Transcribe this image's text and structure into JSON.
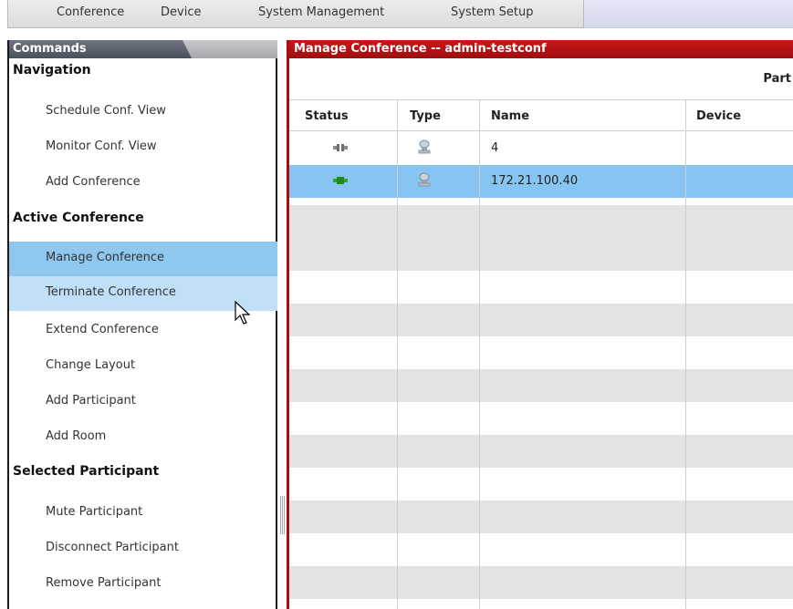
{
  "menu": {
    "items": [
      "Conference",
      "Device",
      "System Management",
      "System Setup"
    ]
  },
  "commands": {
    "title": "Commands",
    "sections": [
      {
        "label": "Navigation",
        "items": [
          "Schedule Conf. View",
          "Monitor Conf. View",
          "Add Conference"
        ]
      },
      {
        "label": "Active Conference",
        "items": [
          "Manage Conference",
          "Terminate Conference",
          "Extend Conference",
          "Change Layout",
          "Add Participant",
          "Add Room"
        ]
      },
      {
        "label": "Selected Participant",
        "items": [
          "Mute Participant",
          "Disconnect Participant",
          "Remove Participant"
        ]
      }
    ],
    "selected_item": "Manage Conference",
    "hovered_item": "Terminate Conference"
  },
  "main": {
    "title": "Manage Conference -- admin-testconf",
    "subheader": "Part",
    "columns": [
      "Status",
      "Type",
      "Name",
      "Device"
    ],
    "rows": [
      {
        "status": "disconnected",
        "type": "endpoint",
        "name": "4",
        "device": ""
      },
      {
        "status": "connected",
        "type": "endpoint",
        "name": "172.21.100.40",
        "device": "",
        "selected": true
      }
    ]
  },
  "colors": {
    "title_red": "#b01214",
    "selected_blue": "#8fc7ee",
    "hover_blue": "#bfe0f8",
    "connected_green": "#28a81c",
    "disconnected_gray": "#8a8a8a"
  }
}
